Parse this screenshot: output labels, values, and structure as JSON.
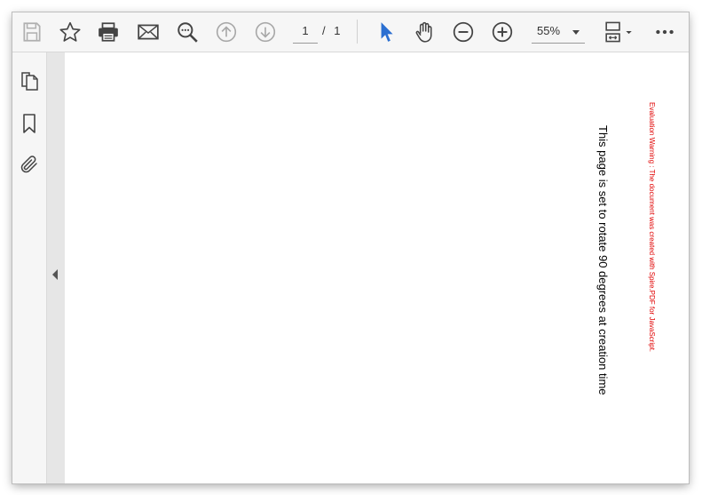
{
  "toolbar": {
    "page": {
      "current": "1",
      "separator": "/",
      "total": "1"
    },
    "zoom": {
      "value": "55%"
    },
    "icons": [
      "save-icon",
      "star-icon",
      "print-icon",
      "mail-icon",
      "search-icon",
      "prev-page-icon",
      "next-page-icon",
      "select-cursor-icon",
      "hand-icon",
      "zoom-out-icon",
      "zoom-in-icon",
      "page-fit-icon",
      "more-icon"
    ]
  },
  "sidebar": {
    "icons": [
      "pages-icon",
      "bookmark-icon",
      "attachment-icon"
    ]
  },
  "document": {
    "rotated_text": "This page is set to rotate 90 degrees at creation time",
    "warning": "Evaluation Warning : The document was created with Spire.PDF for JavaScript."
  },
  "colors": {
    "accent": "#2b6fd1",
    "warning": "#e00000"
  }
}
